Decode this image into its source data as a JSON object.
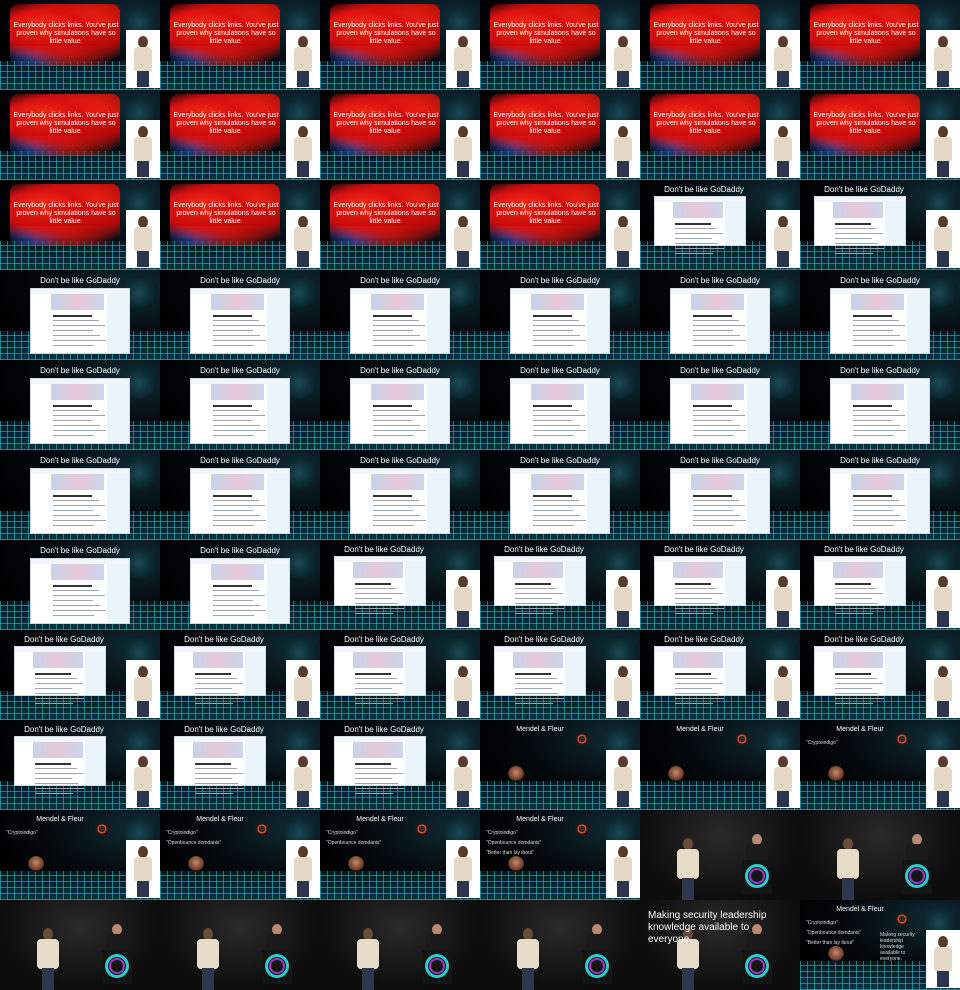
{
  "sheet": {
    "columns": 6,
    "rows": 11
  },
  "slides": {
    "fish": {
      "text": "Everybody clicks links. You've just proven why simulations have so little value."
    },
    "godaddy": {
      "title": "Don't be like GoDaddy",
      "page_heading": "Happy Holiday to Hold"
    },
    "mendel": {
      "title": "Mendel & Fleur",
      "items": [
        "\"Cryptoindigo\"",
        "\"Openbounce domdanis\"",
        "\"Better than lay ibout\""
      ],
      "right_text": "Making security leadership knowledge available to everyone."
    },
    "closing": {
      "caption": "Making security leadership knowledge available to everyone."
    }
  },
  "frames": [
    "fish",
    "fish",
    "fish",
    "fish",
    "fish",
    "fish",
    "fish",
    "fish",
    "fish",
    "fish",
    "fish",
    "fish",
    "fish",
    "fish",
    "fish",
    "fish",
    "godaddy-speaker",
    "godaddy-speaker",
    "godaddy",
    "godaddy",
    "godaddy",
    "godaddy",
    "godaddy",
    "godaddy",
    "godaddy",
    "godaddy",
    "godaddy",
    "godaddy",
    "godaddy",
    "godaddy",
    "godaddy",
    "godaddy",
    "godaddy",
    "godaddy",
    "godaddy",
    "godaddy",
    "godaddy",
    "godaddy",
    "godaddy-speaker",
    "godaddy-speaker",
    "godaddy-speaker",
    "godaddy-speaker",
    "godaddy-speaker",
    "godaddy-speaker",
    "godaddy-speaker",
    "godaddy-speaker",
    "godaddy-speaker",
    "godaddy-speaker",
    "godaddy-speaker",
    "godaddy-speaker",
    "godaddy-speaker",
    "mendel-0",
    "mendel-0",
    "mendel-1",
    "mendel-1",
    "mendel-2",
    "mendel-2",
    "mendel-3",
    "live",
    "live",
    "live",
    "live",
    "live",
    "live",
    "live-caption",
    "mendel-full"
  ]
}
